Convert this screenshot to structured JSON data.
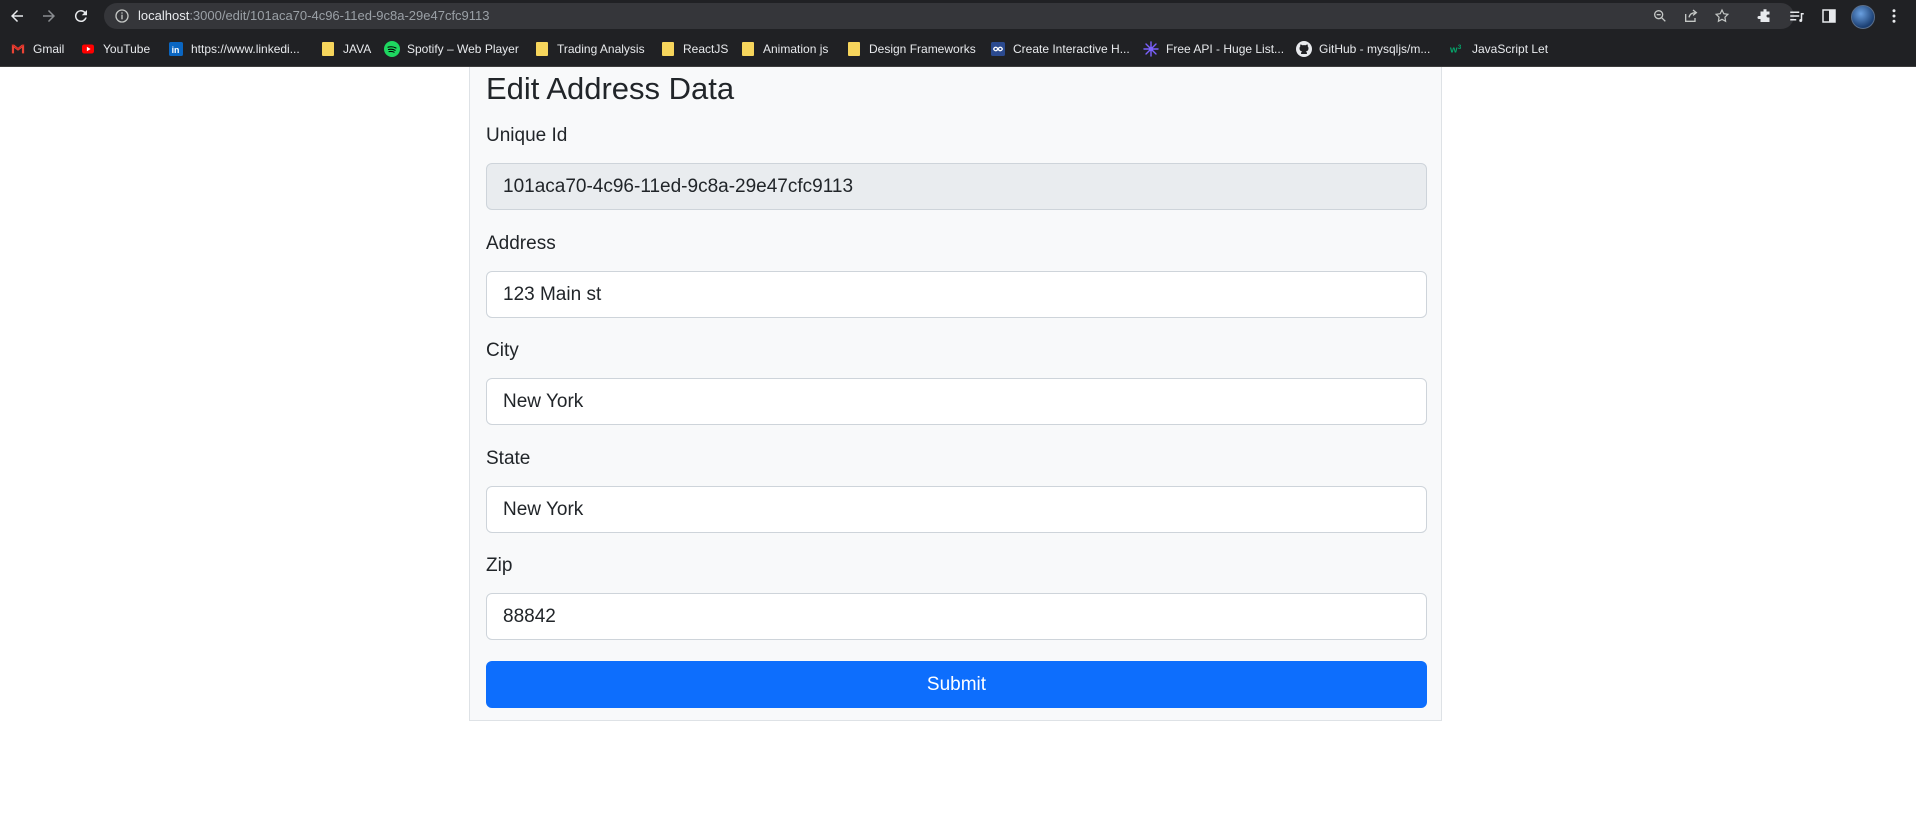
{
  "browser": {
    "url_host": "localhost",
    "url_rest": ":3000/edit/101aca70-4c96-11ed-9c8a-29e47cfc9113",
    "bookmarks": [
      {
        "label": "Gmail",
        "icon": "gmail-icon"
      },
      {
        "label": "YouTube",
        "icon": "youtube-icon"
      },
      {
        "label": "https://www.linkedi...",
        "icon": "linkedin-icon"
      },
      {
        "label": "JAVA",
        "icon": "folder-icon"
      },
      {
        "label": "Spotify – Web Player",
        "icon": "spotify-icon"
      },
      {
        "label": "Trading Analysis",
        "icon": "folder-icon"
      },
      {
        "label": "ReactJS",
        "icon": "folder-icon"
      },
      {
        "label": "Animation js",
        "icon": "folder-icon"
      },
      {
        "label": "Design Frameworks",
        "icon": "folder-icon"
      },
      {
        "label": "Create Interactive H...",
        "icon": "infinity-icon"
      },
      {
        "label": "Free API - Huge List...",
        "icon": "api-icon"
      },
      {
        "label": "GitHub - mysqljs/m...",
        "icon": "github-icon"
      },
      {
        "label": "JavaScript Let",
        "icon": "w3-icon"
      }
    ]
  },
  "form": {
    "title": "Edit Address Data",
    "unique_id": {
      "label": "Unique Id",
      "value": "101aca70-4c96-11ed-9c8a-29e47cfc9113"
    },
    "address": {
      "label": "Address",
      "value": "123 Main st"
    },
    "city": {
      "label": "City",
      "value": "New York"
    },
    "state": {
      "label": "State",
      "value": "New York"
    },
    "zip": {
      "label": "Zip",
      "value": "88842"
    },
    "submit_label": "Submit"
  },
  "colors": {
    "primary": "#0d6efd",
    "card_background": "#f8f9fa",
    "disabled_input": "#e9ecef"
  }
}
